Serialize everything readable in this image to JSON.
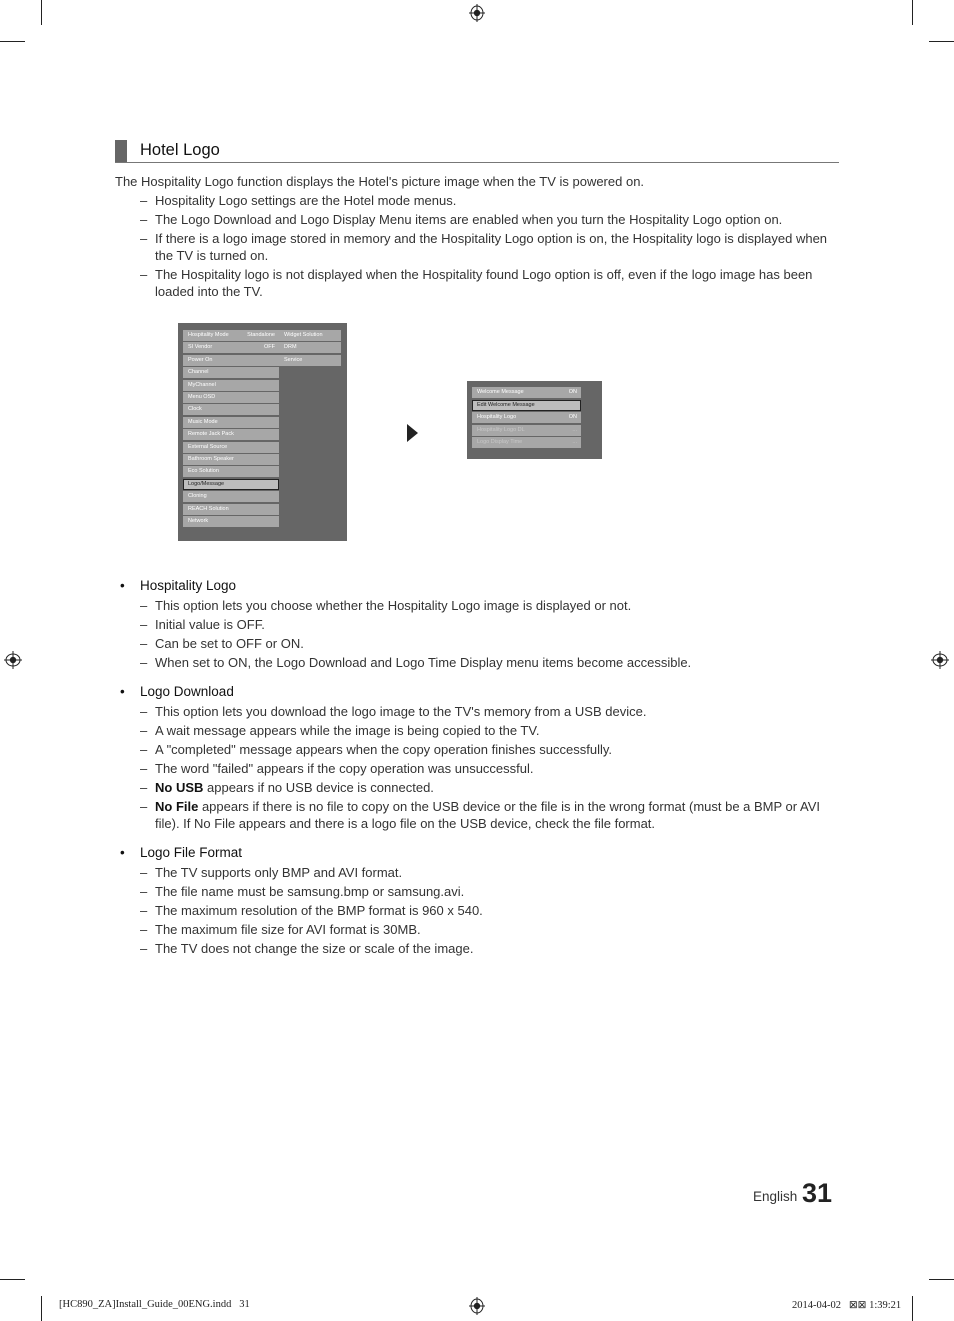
{
  "section": {
    "title": "Hotel Logo"
  },
  "intro": "The Hospitality Logo function displays the Hotel's picture image when the TV is powered on.",
  "intro_items": [
    "Hospitality Logo settings are the Hotel mode menus.",
    "The Logo Download and Logo Display Menu items are enabled when you turn the Hospitality Logo option on.",
    "If there is a logo image stored in memory and the Hospitality Logo option is on, the Hospitality logo is displayed when the TV is turned on.",
    "The Hospitality logo is not displayed when the Hospitality found Logo option is off, even if the logo image has been loaded into the TV."
  ],
  "menu_main": {
    "left": [
      {
        "label": "Hospitality Mode",
        "value": "Standalone"
      },
      {
        "label": "SI Vendor",
        "value": "OFF"
      },
      {
        "label": "Power On",
        "value": ""
      },
      {
        "label": "Channel",
        "value": ""
      },
      {
        "label": "MyChannel",
        "value": ""
      },
      {
        "label": "Menu OSD",
        "value": ""
      },
      {
        "label": "Clock",
        "value": ""
      },
      {
        "label": "Music Mode",
        "value": ""
      },
      {
        "label": "Remote Jack Pack",
        "value": ""
      },
      {
        "label": "External Source",
        "value": ""
      },
      {
        "label": "Bathroom Speaker",
        "value": ""
      },
      {
        "label": "Eco Solution",
        "value": ""
      },
      {
        "label": "Logo/Message",
        "value": "",
        "selected": true
      },
      {
        "label": "Cloning",
        "value": ""
      },
      {
        "label": "REACH Solution",
        "value": ""
      },
      {
        "label": "Network",
        "value": ""
      }
    ],
    "right": [
      "Widget Solution",
      "DRM",
      "Service"
    ]
  },
  "menu_sub": [
    {
      "label": "Welcome Message",
      "value": "ON"
    },
    {
      "label": "Edit Welcome Message",
      "value": "",
      "selected": true
    },
    {
      "label": "Hospitality Logo",
      "value": "ON"
    },
    {
      "label": "Hospitality Logo DL",
      "value": "...",
      "dimmed": true
    },
    {
      "label": "Logo Display Time",
      "value": "...",
      "dimmed": true
    }
  ],
  "bullets": [
    {
      "title": "Hospitality Logo",
      "items": [
        {
          "text": "This option lets you choose whether the Hospitality Logo image is displayed or not."
        },
        {
          "text": "Initial value is OFF."
        },
        {
          "text": "Can be set to OFF or ON."
        },
        {
          "text": "When set to ON, the Logo Download and Logo Time Display menu items become accessible."
        }
      ]
    },
    {
      "title": "Logo Download",
      "items": [
        {
          "text": "This option lets you download the logo image to the TV's memory from a USB device."
        },
        {
          "text": "A wait message appears while the image is being copied to the TV."
        },
        {
          "text": "A \"completed\" message appears when the copy operation finishes successfully."
        },
        {
          "text": "The word \"failed\" appears if the copy operation was unsuccessful."
        },
        {
          "bold": "No USB",
          "text": " appears if no USB device is connected."
        },
        {
          "bold": "No File",
          "text": " appears if there is no file to copy on the USB device or the file is in the wrong format (must be a BMP or AVI file). If No File appears and there is a logo file on the USB device, check the file format."
        }
      ]
    },
    {
      "title": "Logo File Format",
      "items": [
        {
          "text": "The TV supports only BMP and AVI format."
        },
        {
          "text": "The file name must be samsung.bmp or samsung.avi."
        },
        {
          "text": "The maximum resolution of the BMP format is 960 x 540."
        },
        {
          "text": "The maximum file size for AVI format is 30MB."
        },
        {
          "text": "The TV does not change the size or scale of the image."
        }
      ]
    }
  ],
  "page": {
    "language": "English",
    "number": "31"
  },
  "footer": {
    "file": "[HC890_ZA]Install_Guide_00ENG.indd   31",
    "timestamp": "2014-04-02   ⊠⊠ 1:39:21"
  },
  "icons": {
    "bullet": "•",
    "registration_mark": "registration-mark-icon",
    "arrow": "play-arrow-icon"
  }
}
